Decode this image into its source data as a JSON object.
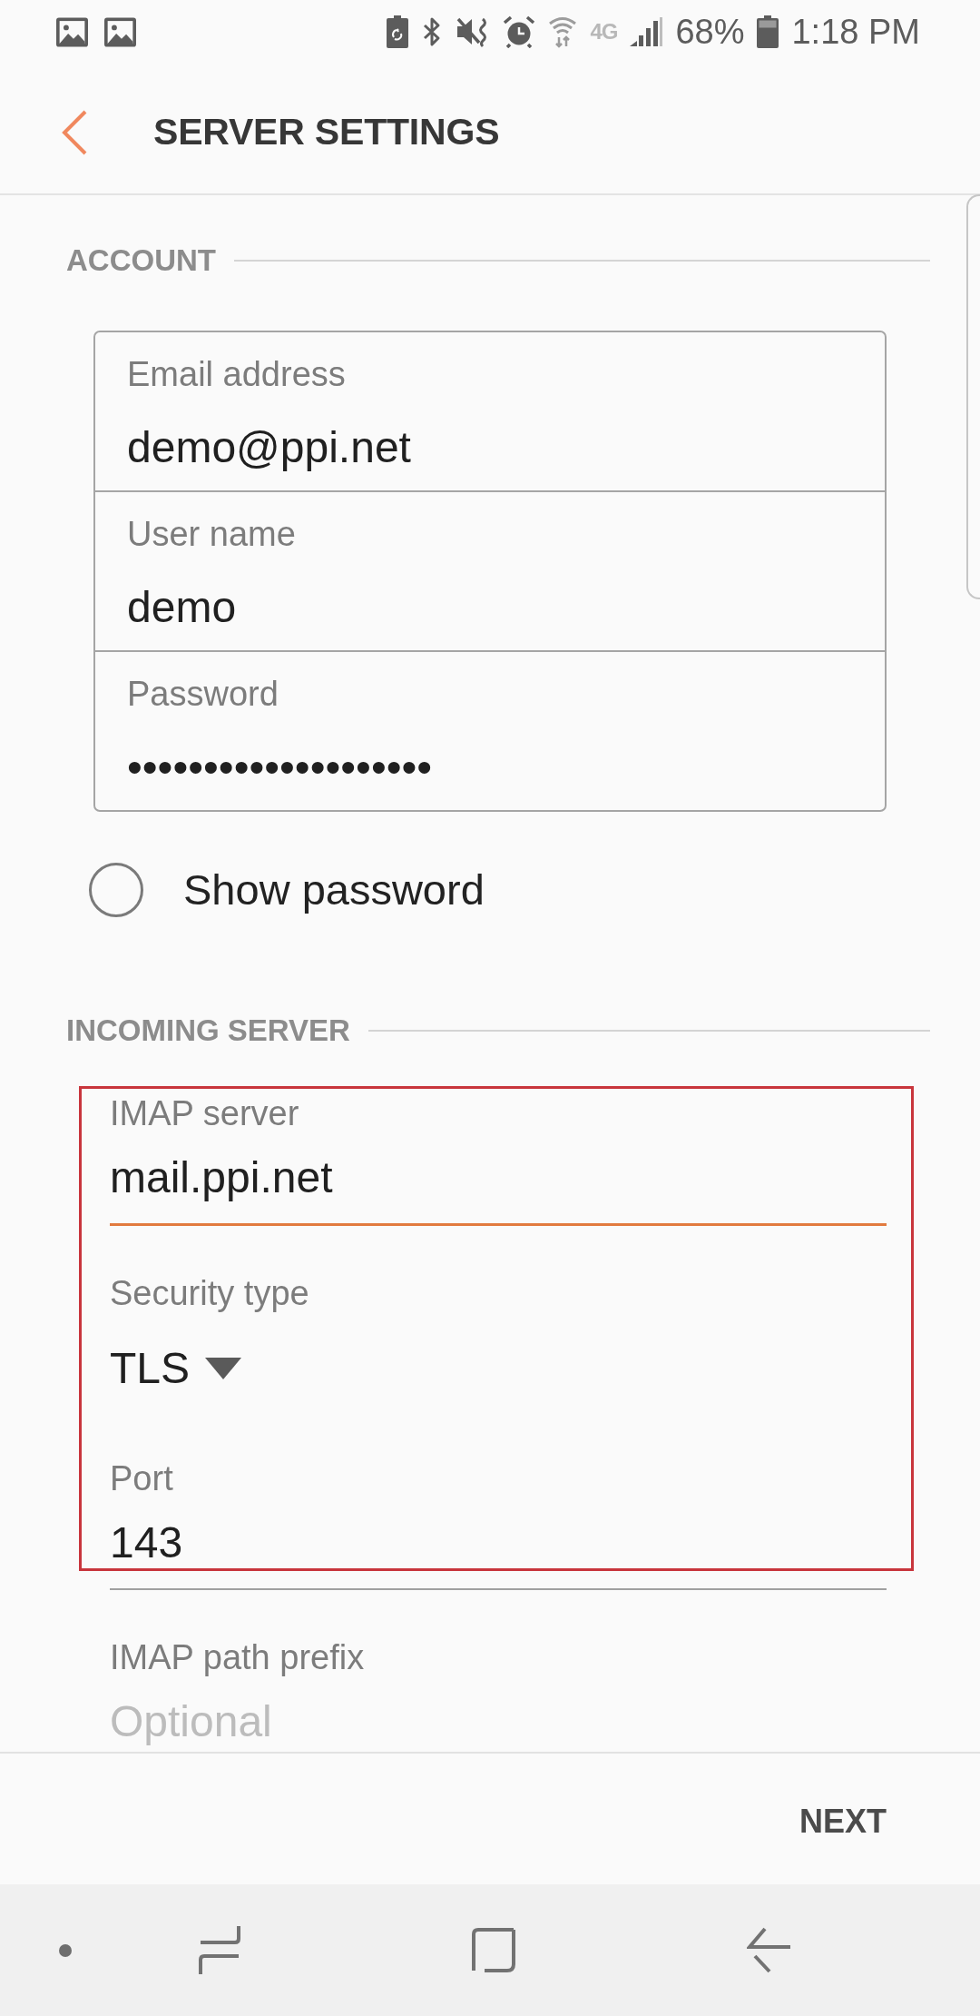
{
  "status_bar": {
    "network": "4G",
    "battery": "68%",
    "time": "1:18 PM"
  },
  "header": {
    "title": "SERVER SETTINGS"
  },
  "account": {
    "title": "ACCOUNT",
    "fields": [
      {
        "label": "Email address",
        "value": "demo@ppi.net"
      },
      {
        "label": "User name",
        "value": "demo"
      },
      {
        "label": "Password",
        "value": "••••••••••••••••••••"
      }
    ],
    "show_password": {
      "label": "Show password",
      "checked": false
    }
  },
  "incoming_server": {
    "title": "INCOMING SERVER",
    "fields": [
      {
        "kind": "text",
        "label": "IMAP server",
        "value": "mail.ppi.net",
        "focused": true,
        "highlighted": true
      },
      {
        "kind": "dropdown",
        "label": "Security type",
        "value": "TLS",
        "highlighted": true
      },
      {
        "kind": "text",
        "label": "Port",
        "value": "143",
        "focused": false,
        "highlighted": true
      },
      {
        "kind": "text",
        "label": "IMAP path prefix",
        "placeholder": "Optional",
        "focused": false,
        "highlighted": false
      }
    ]
  },
  "footer": {
    "next_button": "NEXT"
  }
}
